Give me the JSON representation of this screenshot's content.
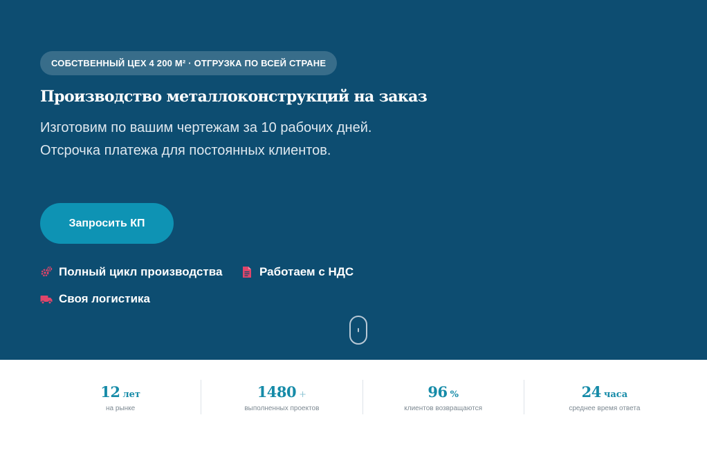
{
  "hero": {
    "badge": "СОБСТВЕННЫЙ ЦЕХ 4 200 М² · ОТГРУЗКА ПО ВСЕЙ СТРАНЕ",
    "title": "Производство металлоконструкций на заказ",
    "subtitle": "Изготовим по вашим чертежам за 10 рабочих дней. Отсрочка платежа для постоянных клиентов.",
    "cta_label": "Запросить КП",
    "features": [
      {
        "icon": "gears-icon",
        "label": "Полный цикл производства"
      },
      {
        "icon": "document-icon",
        "label": "Работаем с НДС"
      },
      {
        "icon": "truck-icon",
        "label": "Своя логистика"
      }
    ],
    "accent_color": "#e0456a",
    "background_color": "#0d4d71",
    "button_color": "#0e93b4"
  },
  "stats": [
    {
      "value": "12",
      "unit": "лет",
      "label": "на рынке"
    },
    {
      "value": "1480",
      "unit": "+",
      "label": "выполненных проектов"
    },
    {
      "value": "96",
      "unit": "%",
      "label": "клиентов возвращаются"
    },
    {
      "value": "24",
      "unit": "часа",
      "label": "среднее время ответа"
    }
  ]
}
